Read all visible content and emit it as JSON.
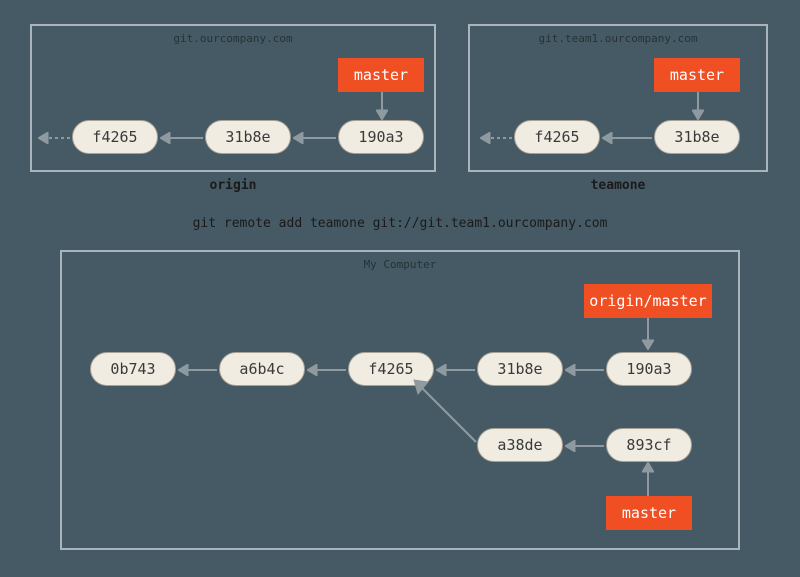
{
  "panels": {
    "origin": {
      "title": "git.ourcompany.com",
      "label": "origin"
    },
    "teamone": {
      "title": "git.team1.ourcompany.com",
      "label": "teamone"
    },
    "local": {
      "title": "My Computer"
    }
  },
  "command": "git remote add teamone git://git.team1.ourcompany.com",
  "branches": {
    "origin_master": "master",
    "teamone_master": "master",
    "local_origin_master": "origin/master",
    "local_master": "master"
  },
  "commits": {
    "origin": [
      "f4265",
      "31b8e",
      "190a3"
    ],
    "teamone": [
      "f4265",
      "31b8e"
    ],
    "local_row1": [
      "0b743",
      "a6b4c",
      "f4265",
      "31b8e",
      "190a3"
    ],
    "local_row2": [
      "a38de",
      "893cf"
    ]
  }
}
